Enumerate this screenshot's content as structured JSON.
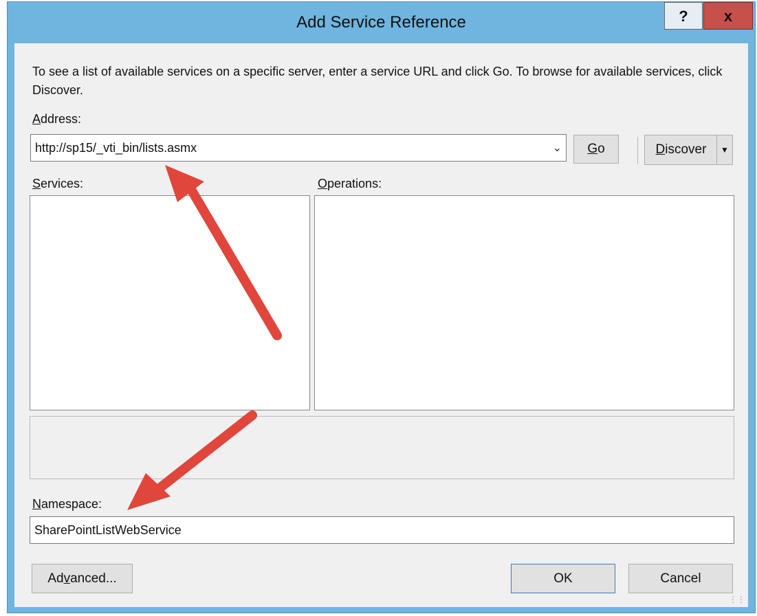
{
  "window": {
    "title": "Add Service Reference",
    "help_label": "?",
    "close_label": "x"
  },
  "description": "To see a list of available services on a specific server, enter a service URL and click Go. To browse for available services, click Discover.",
  "address": {
    "label_first": "A",
    "label_rest": "ddress:",
    "value": "http://sp15/_vti_bin/lists.asmx",
    "dropdown_icon": "chevron-down-icon",
    "go_first": "G",
    "go_rest": "o",
    "discover_first": "D",
    "discover_rest": "iscover",
    "discover_dropdown_icon": "caret-down-icon"
  },
  "services": {
    "label_first": "S",
    "label_rest": "ervices:"
  },
  "operations": {
    "label_first": "O",
    "label_rest": "perations:"
  },
  "namespace": {
    "label_first": "N",
    "label_rest": "amespace:",
    "value": "SharePointListWebService"
  },
  "footer": {
    "advanced_pre": "Ad",
    "advanced_ul": "v",
    "advanced_post": "anced...",
    "ok_label": "OK",
    "cancel_label": "Cancel"
  },
  "colors": {
    "titlebar": "#6fb5e0",
    "close_button": "#c7504a",
    "annotation_arrow": "#e0463c"
  }
}
